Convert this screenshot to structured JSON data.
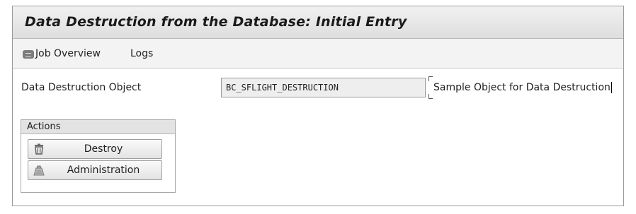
{
  "window": {
    "title": "Data Destruction from the Database: Initial Entry"
  },
  "toolbar": {
    "job_overview_label": "Job Overview",
    "logs_label": "Logs"
  },
  "form": {
    "field_label": "Data Destruction Object",
    "field_value": "BC_SFLIGHT_DESTRUCTION",
    "field_description": "Sample Object for Data Destruction"
  },
  "actions": {
    "group_title": "Actions",
    "destroy_label": "Destroy",
    "administration_label": "Administration"
  },
  "icons": {
    "job_overview": "job-overview-icon",
    "destroy": "trash-icon",
    "administration": "administration-icon"
  }
}
